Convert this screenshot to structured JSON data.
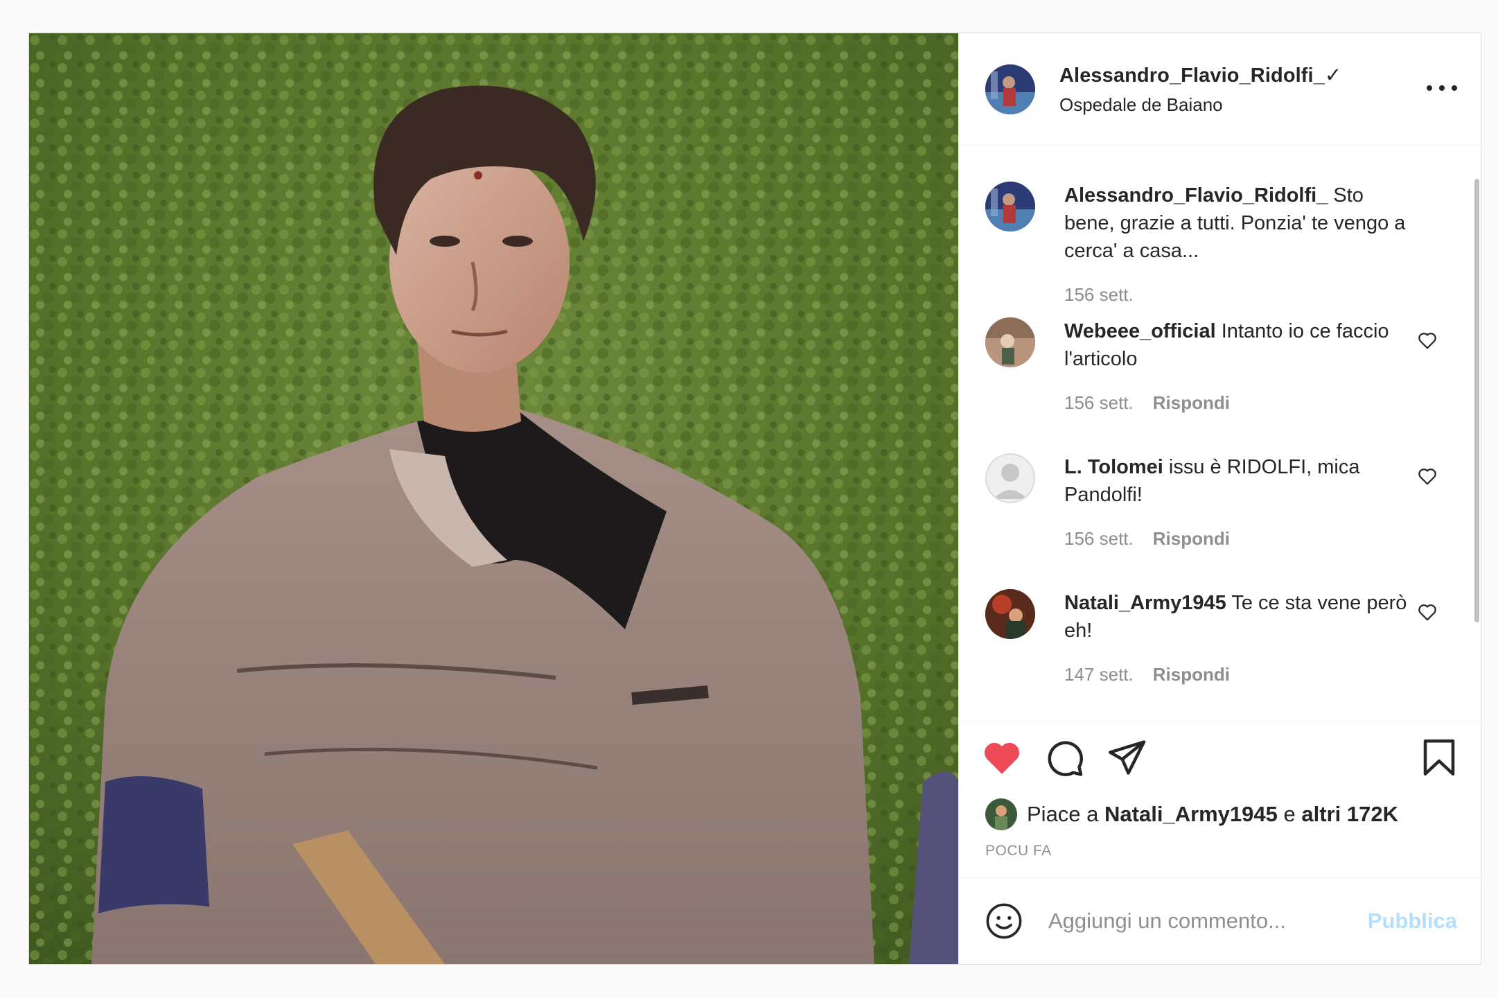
{
  "post": {
    "author": "Alessandro_Flavio_Ridolfi_✓",
    "location": "Ospedale de Baiano"
  },
  "caption": {
    "author": "Alessandro_Flavio_Ridolfi_",
    "text": "Sto bene, grazie a tutti. Ponzia' te vengo a cerca' a casa...",
    "time": "156 sett."
  },
  "comments": [
    {
      "author": "Webeee_official",
      "text": "Intanto io ce faccio l'articolo",
      "time": "156 sett.",
      "reply": "Rispondi"
    },
    {
      "author": "L. Tolomei",
      "text": "issu è RIDOLFI, mica Pandolfi!",
      "time": "156 sett.",
      "reply": "Rispondi"
    },
    {
      "author": "Natali_Army1945",
      "text": "Te ce sta vene però eh!",
      "time": "147 sett.",
      "reply": "Rispondi"
    }
  ],
  "likes": {
    "prefix": "Piace a",
    "user": "Natali_Army1945",
    "conj": "e",
    "others": "altri 172K"
  },
  "timeago": "POCU FA",
  "add_comment": {
    "placeholder": "Aggiungi un commento...",
    "publish": "Pubblica"
  },
  "icons": {
    "like": "heart-icon",
    "comment": "comment-icon",
    "share": "send-icon",
    "save": "bookmark-icon",
    "emoji": "emoji-icon",
    "more": "more-icon"
  },
  "colors": {
    "like_red": "#ed4956",
    "publish_disabled": "#b2dffc",
    "meta_gray": "#8e8e8e"
  }
}
